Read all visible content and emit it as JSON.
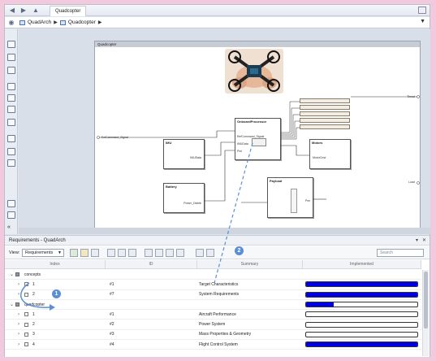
{
  "window": {
    "tab_title": "Quadcopter"
  },
  "breadcrumb": {
    "items": [
      "QuadArch",
      "Quadcopter"
    ]
  },
  "diagram": {
    "model_title": "Quadcopter",
    "blocks": {
      "onboard": "OnboardProcessor",
      "imu": "IMU",
      "motors": "Motors",
      "battery": "Battery",
      "payload": "Payload"
    },
    "ports": {
      "left_input": "ExtCommand_Signal",
      "right_out1": "Thrust",
      "right_out2": "Load",
      "onboard_in1": "RefCommand_Signal",
      "onboard_in2": "IMUData",
      "onboard_in3": "Pwr",
      "imu_out": "IMUData",
      "motors_in": "MotorCmd",
      "battery_out": "Power_Distrib",
      "payload_out": "Pwr"
    }
  },
  "requirements_panel": {
    "title": "Requirements - QuadArch",
    "view_label": "View:",
    "view_value": "Requirements",
    "search_placeholder": "Search",
    "columns": [
      "Index",
      "ID",
      "Summary",
      "Implemented"
    ],
    "rows": [
      {
        "index": "concepts",
        "id": "",
        "summary": "",
        "implemented": null,
        "level": 0
      },
      {
        "index": "1",
        "id": "#1",
        "summary": "Target Characteristics",
        "implemented": 1.0,
        "level": 1
      },
      {
        "index": "2",
        "id": "#7",
        "summary": "System Requirements",
        "implemented": 1.0,
        "level": 1
      },
      {
        "index": "quadcopter",
        "id": "",
        "summary": "",
        "implemented": 0.25,
        "level": 0
      },
      {
        "index": "1",
        "id": "#1",
        "summary": "Aircraft Performance",
        "implemented": 0.0,
        "level": 1
      },
      {
        "index": "2",
        "id": "#2",
        "summary": "Power System",
        "implemented": 0.0,
        "level": 1
      },
      {
        "index": "3",
        "id": "#3",
        "summary": "Mass Properties & Geometry",
        "implemented": 0.0,
        "level": 1
      },
      {
        "index": "4",
        "id": "#4",
        "summary": "Flight Control System",
        "implemented": 1.0,
        "level": 1
      }
    ]
  },
  "callouts": [
    "1",
    "2"
  ],
  "colors": {
    "bar_fill": "#0000e6",
    "callout": "#5b8ed6",
    "background": "#f2c9dd"
  },
  "icons": {
    "back": "back-arrow-icon",
    "forward": "forward-arrow-icon",
    "up": "up-arrow-icon"
  }
}
